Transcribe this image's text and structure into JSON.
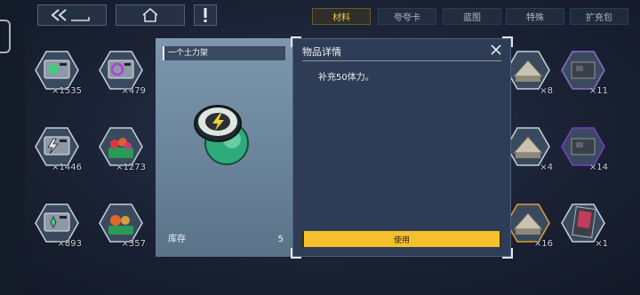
{
  "tabs": [
    {
      "label": "材料",
      "active": true
    },
    {
      "label": "夸夸卡",
      "active": false
    },
    {
      "label": "蓝图",
      "active": false
    },
    {
      "label": "特殊",
      "active": false
    },
    {
      "label": "扩充包",
      "active": false
    }
  ],
  "inventory_left": [
    {
      "icon": "green-battery-crate-icon",
      "count": "×1535"
    },
    {
      "icon": "purple-swirl-crate-icon",
      "count": "×479"
    },
    {
      "icon": "lightning-crate-icon",
      "count": "×1446"
    },
    {
      "icon": "flower-basket-icon",
      "count": "×1273"
    },
    {
      "icon": "green-gear-crate-icon",
      "count": "×893"
    },
    {
      "icon": "fruit-basket-icon",
      "count": "×357"
    }
  ],
  "inventory_right": [
    {
      "icon": "tent-icon",
      "count": "×8"
    },
    {
      "icon": "dark-machine-icon",
      "count": "×11"
    },
    {
      "icon": "tent-icon",
      "count": "×4"
    },
    {
      "icon": "dark-machine-icon",
      "count": "×14"
    },
    {
      "icon": "tent-icon",
      "count": "×16"
    },
    {
      "icon": "card-pack-icon",
      "count": "×1"
    }
  ],
  "item_card": {
    "name": "一个土力架",
    "stock_label": "库存",
    "stock_value": "5",
    "icon": "energy-capsule-icon"
  },
  "detail_panel": {
    "title": "物品详情",
    "description": "补充50体力。",
    "use_label": "使用"
  },
  "colors": {
    "accent": "#f4c02d",
    "tab_active": "#f6c343",
    "panel_bg": "#2e3d55",
    "card_bg": "#7d98ae"
  }
}
